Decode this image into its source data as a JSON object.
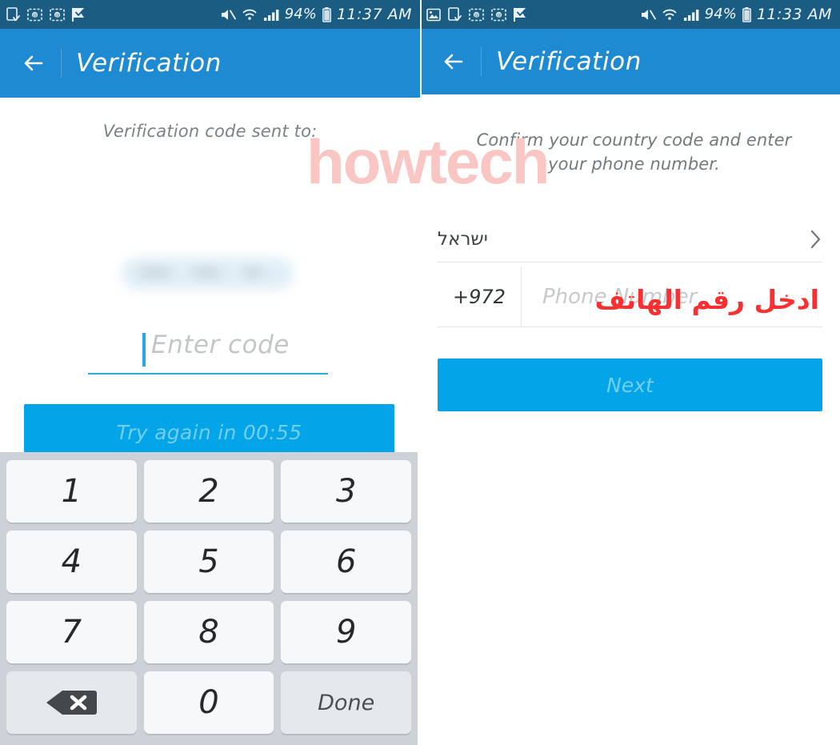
{
  "left_panel": {
    "status_bar": {
      "icons": [
        "document-download-icon",
        "screenshot-icon",
        "screenshot-icon",
        "flag-check-icon"
      ],
      "mute_icon": "mute-icon",
      "wifi_icon": "wifi-icon",
      "signal_icon": "signal-bars-icon",
      "battery_percent": "94%",
      "battery_icon": "battery-icon",
      "time": "11:37 AM"
    },
    "app_bar": {
      "back_icon": "back-arrow-icon",
      "title": "Verification"
    },
    "content": {
      "sent_to_label": "Verification code sent to:",
      "masked_number": "",
      "code_placeholder": "Enter code",
      "retry_button_label": "Try again in 00:55"
    },
    "keypad": {
      "keys": [
        {
          "label": "1",
          "name": "key-1",
          "type": "digit"
        },
        {
          "label": "2",
          "name": "key-2",
          "type": "digit"
        },
        {
          "label": "3",
          "name": "key-3",
          "type": "digit"
        },
        {
          "label": "4",
          "name": "key-4",
          "type": "digit"
        },
        {
          "label": "5",
          "name": "key-5",
          "type": "digit"
        },
        {
          "label": "6",
          "name": "key-6",
          "type": "digit"
        },
        {
          "label": "7",
          "name": "key-7",
          "type": "digit"
        },
        {
          "label": "8",
          "name": "key-8",
          "type": "digit"
        },
        {
          "label": "9",
          "name": "key-9",
          "type": "digit"
        },
        {
          "label": "",
          "name": "key-backspace",
          "type": "backspace"
        },
        {
          "label": "0",
          "name": "key-0",
          "type": "digit"
        },
        {
          "label": "Done",
          "name": "key-done",
          "type": "action"
        }
      ]
    }
  },
  "right_panel": {
    "status_bar": {
      "icons": [
        "image-icon",
        "document-download-icon",
        "screenshot-icon",
        "screenshot-icon",
        "flag-check-icon"
      ],
      "mute_icon": "mute-icon",
      "wifi_icon": "wifi-icon",
      "signal_icon": "signal-bars-icon",
      "battery_percent": "94%",
      "battery_icon": "battery-icon",
      "time": "11:33 AM"
    },
    "app_bar": {
      "back_icon": "back-arrow-icon",
      "title": "Verification"
    },
    "content": {
      "hint": "Confirm your country code and enter your phone number.",
      "country_name": "ישראל",
      "country_chevron": "chevron-right-icon",
      "country_code": "+972",
      "phone_placeholder": "Phone Number",
      "annotation_arabic": "ادخل رقم الهاتف",
      "next_button_label": "Next"
    }
  },
  "watermark": {
    "text": "howtech",
    "color": "#fac6c3"
  },
  "colors": {
    "status_bar": "#1b5c82",
    "app_bar": "#1e8ad1",
    "accent_button": "#03a4e8",
    "button_text_disabled": "#72cff2",
    "keypad_background": "#ccd2d8",
    "key_face": "#f7f8f9",
    "annotation_red": "#fa2f32"
  }
}
